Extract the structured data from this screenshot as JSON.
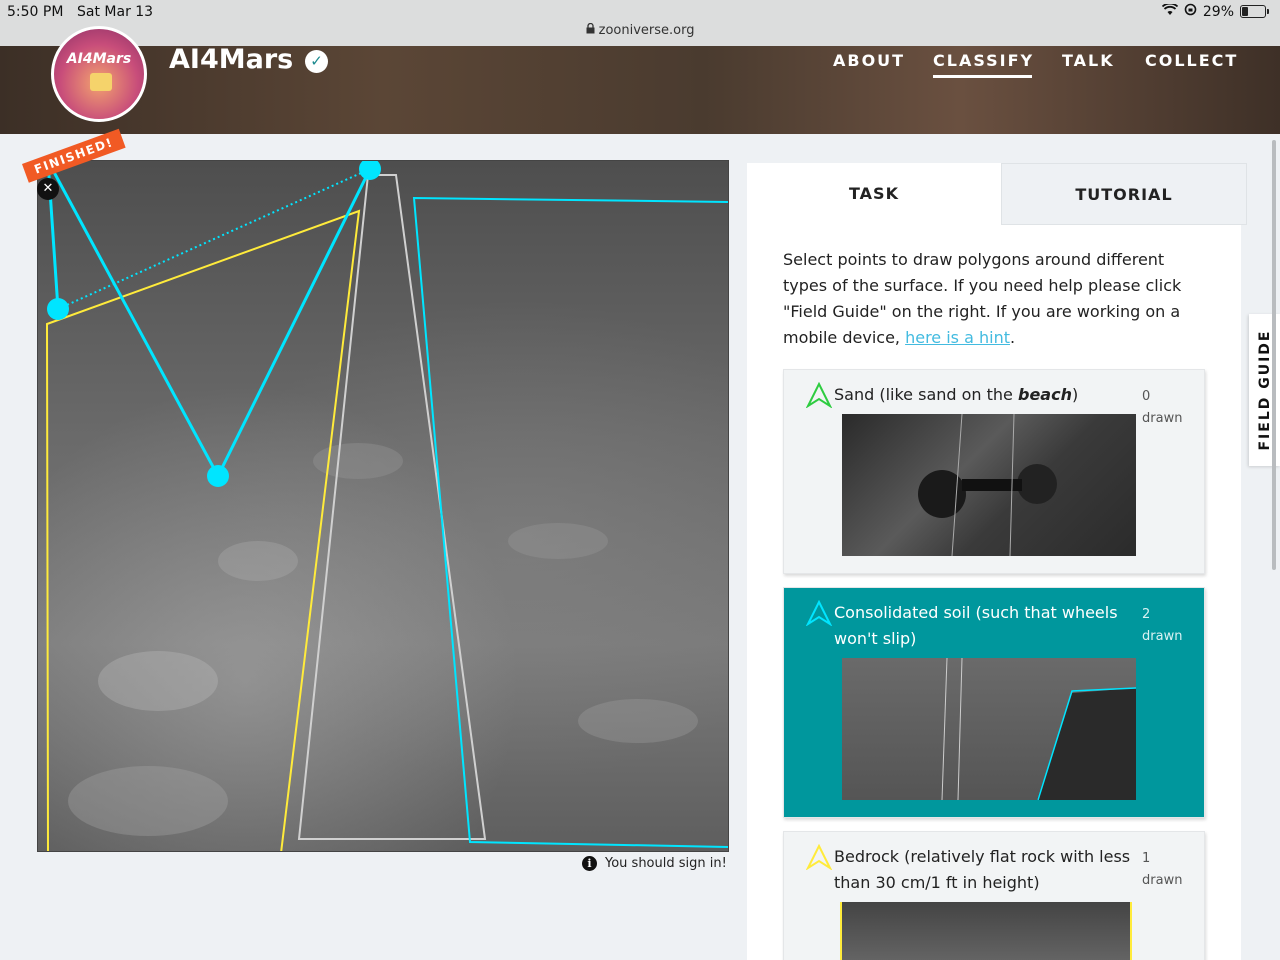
{
  "status_bar": {
    "time": "5:50 PM",
    "date": "Sat Mar 13",
    "battery": "29%",
    "battery_level": 0.29,
    "url": "zooniverse.org"
  },
  "header": {
    "logo_text": "AI4Mars",
    "project_name": "AI4Mars",
    "nav": [
      {
        "label": "ABOUT",
        "active": false
      },
      {
        "label": "CLASSIFY",
        "active": true
      },
      {
        "label": "TALK",
        "active": false
      },
      {
        "label": "COLLECT",
        "active": false
      }
    ]
  },
  "subject": {
    "finished_label": "FINISHED!",
    "sign_in_notice": "You should sign in!"
  },
  "panel": {
    "tabs": {
      "task": "TASK",
      "tutorial": "TUTORIAL"
    },
    "instructions": {
      "text": "Select points to draw polygons around different types of the surface. If you need help please click \"Field Guide\" on the right. If you are working on a mobile device, ",
      "link": "here is a hint",
      "end": "."
    },
    "options": [
      {
        "label_prefix": "Sand (like sand on the ",
        "label_emphasis": "beach",
        "label_suffix": ")",
        "count": "0",
        "count_label": "drawn",
        "color": "#2ecc40",
        "selected": false
      },
      {
        "label": "Consolidated soil (such that wheels won't slip)",
        "count": "2",
        "count_label": "drawn",
        "color": "#00e5ff",
        "selected": true
      },
      {
        "label": "Bedrock (relatively flat rock with less than 30 cm/1 ft in height)",
        "count": "1",
        "count_label": "drawn",
        "color": "#ffeb3b",
        "selected": false
      }
    ]
  },
  "field_guide_label": "FIELD GUIDE",
  "colors": {
    "accent": "#00979d",
    "cyan_tool": "#00e5ff",
    "yellow_tool": "#ffeb3b",
    "finished_badge": "#f15a24"
  }
}
